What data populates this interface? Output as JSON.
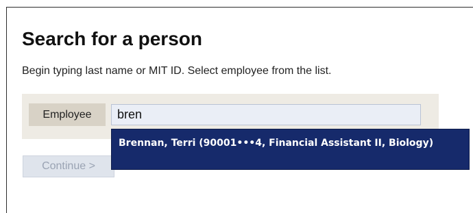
{
  "page": {
    "title": "Search for a person",
    "instructions": "Begin typing last name or MIT ID. Select employee from the list."
  },
  "search": {
    "label": "Employee",
    "value": "bren"
  },
  "suggestions": [
    {
      "text": "Brennan, Terri (90001•••4, Financial Assistant II, Biology)"
    }
  ],
  "actions": {
    "continue_label": "Continue >",
    "continue_disabled": true
  },
  "colors": {
    "suggestion_bg": "#162a6b",
    "panel_bg": "#eeebe4",
    "label_bg": "#d8d2c6",
    "input_bg": "#eaeef6"
  }
}
